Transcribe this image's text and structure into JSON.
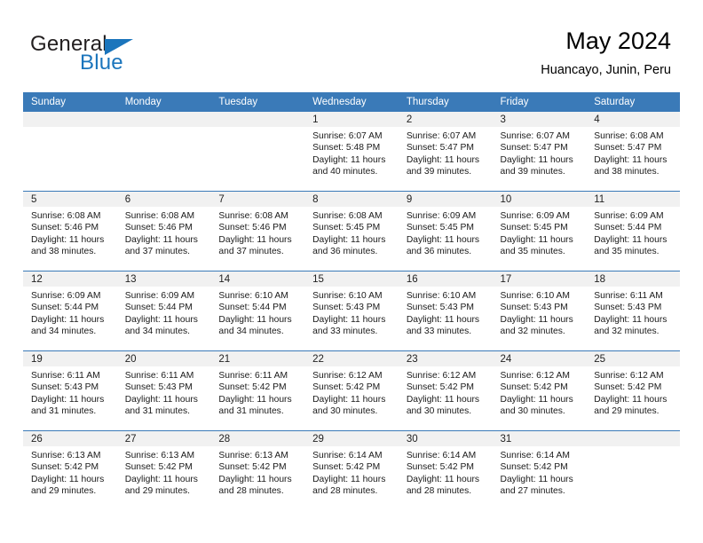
{
  "logo": {
    "word_one": "General",
    "word_two": "Blue",
    "triangle_icon": "triangle-icon",
    "brand_color": "#1b75bc",
    "text_color": "#231f20"
  },
  "header": {
    "title": "May 2024",
    "subtitle": "Huancayo, Junin, Peru"
  },
  "calendar": {
    "accent_color": "#3a7ab8",
    "daynum_band_color": "#f1f1f1",
    "weekday_headers": [
      "Sunday",
      "Monday",
      "Tuesday",
      "Wednesday",
      "Thursday",
      "Friday",
      "Saturday"
    ],
    "weeks": [
      [
        {
          "day": "",
          "lines": []
        },
        {
          "day": "",
          "lines": []
        },
        {
          "day": "",
          "lines": []
        },
        {
          "day": "1",
          "lines": [
            "Sunrise: 6:07 AM",
            "Sunset: 5:48 PM",
            "Daylight: 11 hours",
            "and 40 minutes."
          ]
        },
        {
          "day": "2",
          "lines": [
            "Sunrise: 6:07 AM",
            "Sunset: 5:47 PM",
            "Daylight: 11 hours",
            "and 39 minutes."
          ]
        },
        {
          "day": "3",
          "lines": [
            "Sunrise: 6:07 AM",
            "Sunset: 5:47 PM",
            "Daylight: 11 hours",
            "and 39 minutes."
          ]
        },
        {
          "day": "4",
          "lines": [
            "Sunrise: 6:08 AM",
            "Sunset: 5:47 PM",
            "Daylight: 11 hours",
            "and 38 minutes."
          ]
        }
      ],
      [
        {
          "day": "5",
          "lines": [
            "Sunrise: 6:08 AM",
            "Sunset: 5:46 PM",
            "Daylight: 11 hours",
            "and 38 minutes."
          ]
        },
        {
          "day": "6",
          "lines": [
            "Sunrise: 6:08 AM",
            "Sunset: 5:46 PM",
            "Daylight: 11 hours",
            "and 37 minutes."
          ]
        },
        {
          "day": "7",
          "lines": [
            "Sunrise: 6:08 AM",
            "Sunset: 5:46 PM",
            "Daylight: 11 hours",
            "and 37 minutes."
          ]
        },
        {
          "day": "8",
          "lines": [
            "Sunrise: 6:08 AM",
            "Sunset: 5:45 PM",
            "Daylight: 11 hours",
            "and 36 minutes."
          ]
        },
        {
          "day": "9",
          "lines": [
            "Sunrise: 6:09 AM",
            "Sunset: 5:45 PM",
            "Daylight: 11 hours",
            "and 36 minutes."
          ]
        },
        {
          "day": "10",
          "lines": [
            "Sunrise: 6:09 AM",
            "Sunset: 5:45 PM",
            "Daylight: 11 hours",
            "and 35 minutes."
          ]
        },
        {
          "day": "11",
          "lines": [
            "Sunrise: 6:09 AM",
            "Sunset: 5:44 PM",
            "Daylight: 11 hours",
            "and 35 minutes."
          ]
        }
      ],
      [
        {
          "day": "12",
          "lines": [
            "Sunrise: 6:09 AM",
            "Sunset: 5:44 PM",
            "Daylight: 11 hours",
            "and 34 minutes."
          ]
        },
        {
          "day": "13",
          "lines": [
            "Sunrise: 6:09 AM",
            "Sunset: 5:44 PM",
            "Daylight: 11 hours",
            "and 34 minutes."
          ]
        },
        {
          "day": "14",
          "lines": [
            "Sunrise: 6:10 AM",
            "Sunset: 5:44 PM",
            "Daylight: 11 hours",
            "and 34 minutes."
          ]
        },
        {
          "day": "15",
          "lines": [
            "Sunrise: 6:10 AM",
            "Sunset: 5:43 PM",
            "Daylight: 11 hours",
            "and 33 minutes."
          ]
        },
        {
          "day": "16",
          "lines": [
            "Sunrise: 6:10 AM",
            "Sunset: 5:43 PM",
            "Daylight: 11 hours",
            "and 33 minutes."
          ]
        },
        {
          "day": "17",
          "lines": [
            "Sunrise: 6:10 AM",
            "Sunset: 5:43 PM",
            "Daylight: 11 hours",
            "and 32 minutes."
          ]
        },
        {
          "day": "18",
          "lines": [
            "Sunrise: 6:11 AM",
            "Sunset: 5:43 PM",
            "Daylight: 11 hours",
            "and 32 minutes."
          ]
        }
      ],
      [
        {
          "day": "19",
          "lines": [
            "Sunrise: 6:11 AM",
            "Sunset: 5:43 PM",
            "Daylight: 11 hours",
            "and 31 minutes."
          ]
        },
        {
          "day": "20",
          "lines": [
            "Sunrise: 6:11 AM",
            "Sunset: 5:43 PM",
            "Daylight: 11 hours",
            "and 31 minutes."
          ]
        },
        {
          "day": "21",
          "lines": [
            "Sunrise: 6:11 AM",
            "Sunset: 5:42 PM",
            "Daylight: 11 hours",
            "and 31 minutes."
          ]
        },
        {
          "day": "22",
          "lines": [
            "Sunrise: 6:12 AM",
            "Sunset: 5:42 PM",
            "Daylight: 11 hours",
            "and 30 minutes."
          ]
        },
        {
          "day": "23",
          "lines": [
            "Sunrise: 6:12 AM",
            "Sunset: 5:42 PM",
            "Daylight: 11 hours",
            "and 30 minutes."
          ]
        },
        {
          "day": "24",
          "lines": [
            "Sunrise: 6:12 AM",
            "Sunset: 5:42 PM",
            "Daylight: 11 hours",
            "and 30 minutes."
          ]
        },
        {
          "day": "25",
          "lines": [
            "Sunrise: 6:12 AM",
            "Sunset: 5:42 PM",
            "Daylight: 11 hours",
            "and 29 minutes."
          ]
        }
      ],
      [
        {
          "day": "26",
          "lines": [
            "Sunrise: 6:13 AM",
            "Sunset: 5:42 PM",
            "Daylight: 11 hours",
            "and 29 minutes."
          ]
        },
        {
          "day": "27",
          "lines": [
            "Sunrise: 6:13 AM",
            "Sunset: 5:42 PM",
            "Daylight: 11 hours",
            "and 29 minutes."
          ]
        },
        {
          "day": "28",
          "lines": [
            "Sunrise: 6:13 AM",
            "Sunset: 5:42 PM",
            "Daylight: 11 hours",
            "and 28 minutes."
          ]
        },
        {
          "day": "29",
          "lines": [
            "Sunrise: 6:14 AM",
            "Sunset: 5:42 PM",
            "Daylight: 11 hours",
            "and 28 minutes."
          ]
        },
        {
          "day": "30",
          "lines": [
            "Sunrise: 6:14 AM",
            "Sunset: 5:42 PM",
            "Daylight: 11 hours",
            "and 28 minutes."
          ]
        },
        {
          "day": "31",
          "lines": [
            "Sunrise: 6:14 AM",
            "Sunset: 5:42 PM",
            "Daylight: 11 hours",
            "and 27 minutes."
          ]
        },
        {
          "day": "",
          "lines": []
        }
      ]
    ]
  }
}
